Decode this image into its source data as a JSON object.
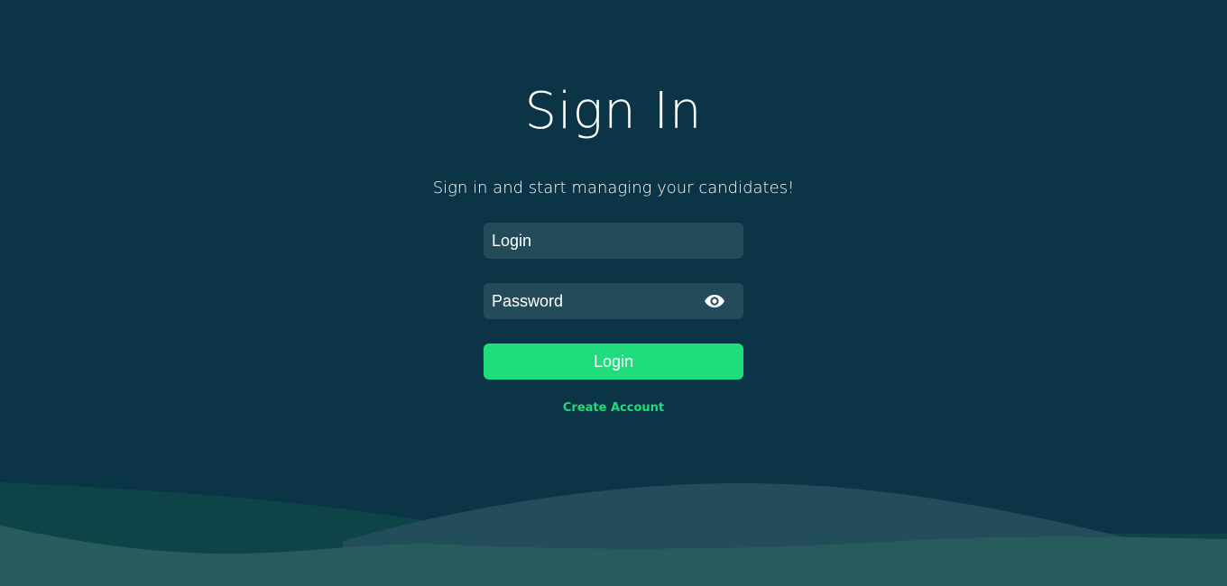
{
  "page": {
    "title": "Sign In",
    "subtitle": "Sign in and start managing your candidates!"
  },
  "form": {
    "login_placeholder": "Login",
    "login_value": "",
    "password_placeholder": "Password",
    "password_value": "",
    "password_toggle_icon": "eye-icon",
    "submit_label": "Login",
    "create_account_label": "Create Account"
  },
  "colors": {
    "background": "#0b3546",
    "input_background": "#234b5a",
    "accent": "#1fdc7c",
    "text": "#ffffff",
    "wave_back": "#0c4448",
    "wave_mid": "#244d5c",
    "wave_front": "#285b5c"
  }
}
